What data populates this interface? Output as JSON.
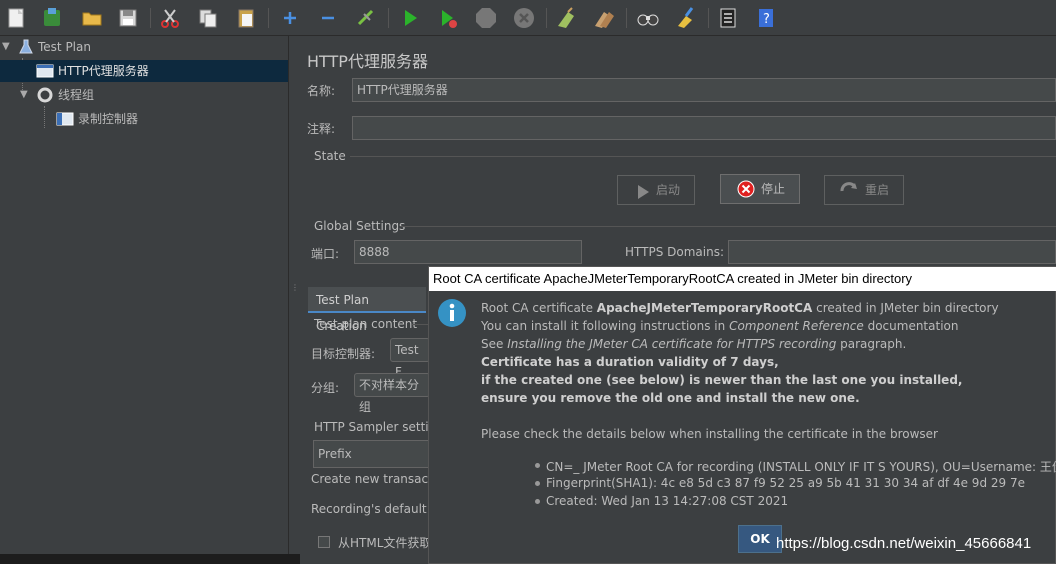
{
  "tree": {
    "items": [
      {
        "label": "Test Plan"
      },
      {
        "label": "HTTP代理服务器"
      },
      {
        "label": "线程组"
      },
      {
        "label": "录制控制器"
      }
    ]
  },
  "main": {
    "title": "HTTP代理服务器",
    "name_label": "名称:",
    "name_value": "HTTP代理服务器",
    "comment_label": "注释:",
    "comment_value": "",
    "state": {
      "title": "State",
      "start_label": "启动",
      "stop_label": "停止",
      "restart_label": "重启"
    },
    "global": {
      "title": "Global Settings",
      "port_label": "端口:",
      "port_value": "8888",
      "https_label": "HTTPS Domains:",
      "https_value": ""
    },
    "tabs": [
      {
        "label": "Test Plan Creation"
      }
    ],
    "content": {
      "title": "Test plan content",
      "target_label": "目标控制器:",
      "target_value": "Test F",
      "group_label": "分组:",
      "group_value": "不对样本分组",
      "sampler_title": "HTTP Sampler settin",
      "prefix_value": "Prefix",
      "create_label": "Create new transactio",
      "recording_label": "Recording's default e",
      "html_label": "从HTML文件获取"
    }
  },
  "dialog": {
    "title": "Root CA certificate ApacheJMeterTemporaryRootCA created in JMeter bin directory",
    "line1_pre": "Root CA certificate ",
    "line1_bold": "ApacheJMeterTemporaryRootCA",
    "line1_post": " created in JMeter bin directory",
    "line2_pre": "You can install it following instructions in ",
    "line2_italic": "Component Reference",
    "line2_post": " documentation",
    "line3_pre": "See ",
    "line3_italic": "Installing the JMeter CA certificate for HTTPS recording",
    "line3_post": " paragraph.",
    "line4": "Certificate has a duration validity of 7 days,",
    "line5": "if the created one (see below) is newer than the last one you installed,",
    "line6": "ensure you remove the old one and install the new one.",
    "line7": "Please check the details below when installing the certificate in the browser",
    "bullets": [
      "CN=_ JMeter Root CA for recording (INSTALL ONLY IF IT S YOURS), OU=Username: 王佳俊, C",
      "Fingerprint(SHA1): 4c e8 5d c3 87 f9 52 25 a9 5b 41 31 30 34 af df 4e 9d 29 7e",
      "Created: Wed Jan 13 14:27:08 CST 2021"
    ],
    "ok_label": "OK"
  },
  "watermark": "https://blog.csdn.net/weixin_45666841",
  "colors": {
    "background": "#3c3f41",
    "selection": "#0d293e",
    "accent": "#4a88c7",
    "ok_button": "#365880"
  }
}
